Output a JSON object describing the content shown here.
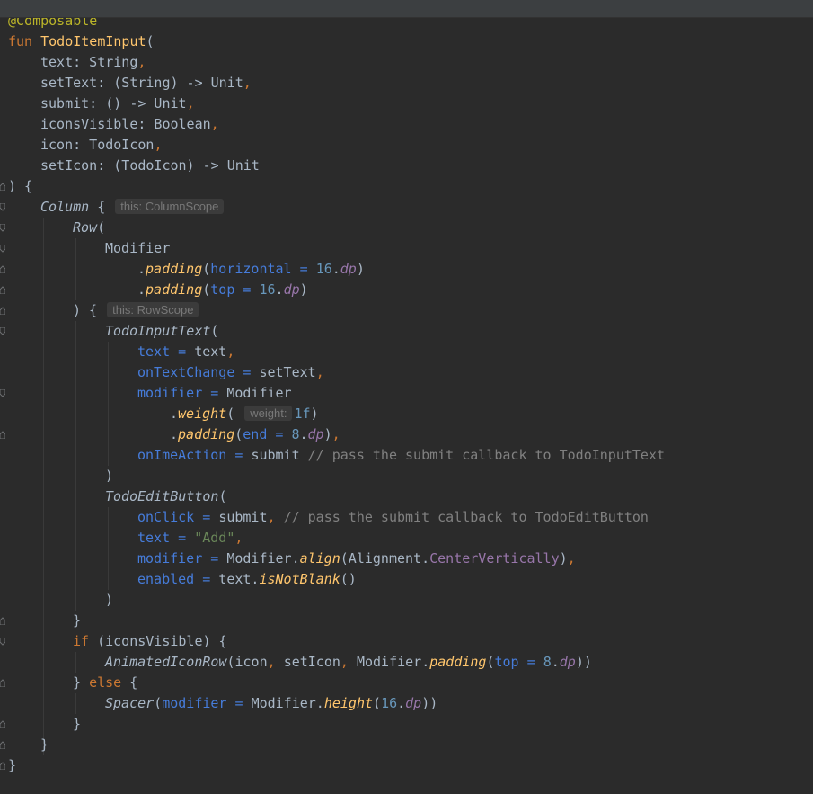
{
  "editor": {
    "language": "Kotlin",
    "lines": [
      {
        "indent": 0,
        "fold": null,
        "tokens": [
          {
            "t": "@Composable",
            "c": "ann"
          }
        ]
      },
      {
        "indent": 0,
        "fold": null,
        "tokens": [
          {
            "t": "fun ",
            "c": "kw"
          },
          {
            "t": "TodoItemInput",
            "c": "fn"
          },
          {
            "t": "(",
            "c": "plain"
          }
        ]
      },
      {
        "indent": 1,
        "fold": null,
        "tokens": [
          {
            "t": "text: String",
            "c": "plain"
          },
          {
            "t": ",",
            "c": "punct-o"
          }
        ]
      },
      {
        "indent": 1,
        "fold": null,
        "tokens": [
          {
            "t": "setText: (String) -> Unit",
            "c": "plain"
          },
          {
            "t": ",",
            "c": "punct-o"
          }
        ]
      },
      {
        "indent": 1,
        "fold": null,
        "tokens": [
          {
            "t": "submit: () -> Unit",
            "c": "plain"
          },
          {
            "t": ",",
            "c": "punct-o"
          }
        ]
      },
      {
        "indent": 1,
        "fold": null,
        "tokens": [
          {
            "t": "iconsVisible: Boolean",
            "c": "plain"
          },
          {
            "t": ",",
            "c": "punct-o"
          }
        ]
      },
      {
        "indent": 1,
        "fold": null,
        "tokens": [
          {
            "t": "icon: TodoIcon",
            "c": "plain"
          },
          {
            "t": ",",
            "c": "punct-o"
          }
        ]
      },
      {
        "indent": 1,
        "fold": null,
        "tokens": [
          {
            "t": "setIcon: (TodoIcon) -> Unit",
            "c": "plain"
          }
        ]
      },
      {
        "indent": 0,
        "fold": "end",
        "tokens": [
          {
            "t": ") {",
            "c": "plain"
          }
        ]
      },
      {
        "indent": 1,
        "fold": "start",
        "tokens": [
          {
            "t": "Column",
            "c": "call"
          },
          {
            "t": " { ",
            "c": "plain"
          },
          {
            "t": "this: ColumnScope",
            "c": "hint"
          }
        ]
      },
      {
        "indent": 2,
        "fold": "start",
        "tokens": [
          {
            "t": "Row",
            "c": "call"
          },
          {
            "t": "(",
            "c": "plain"
          }
        ]
      },
      {
        "indent": 3,
        "fold": "start",
        "tokens": [
          {
            "t": "Modifier",
            "c": "plain"
          }
        ]
      },
      {
        "indent": 4,
        "fold": "end",
        "tokens": [
          {
            "t": ".",
            "c": "plain"
          },
          {
            "t": "padding",
            "c": "ext"
          },
          {
            "t": "(",
            "c": "plain"
          },
          {
            "t": "horizontal = ",
            "c": "named"
          },
          {
            "t": "16",
            "c": "num"
          },
          {
            "t": ".",
            "c": "plain"
          },
          {
            "t": "dp",
            "c": "prop"
          },
          {
            "t": ")",
            "c": "plain"
          }
        ]
      },
      {
        "indent": 4,
        "fold": "end",
        "tokens": [
          {
            "t": ".",
            "c": "plain"
          },
          {
            "t": "padding",
            "c": "ext"
          },
          {
            "t": "(",
            "c": "plain"
          },
          {
            "t": "top = ",
            "c": "named"
          },
          {
            "t": "16",
            "c": "num"
          },
          {
            "t": ".",
            "c": "plain"
          },
          {
            "t": "dp",
            "c": "prop"
          },
          {
            "t": ")",
            "c": "plain"
          }
        ]
      },
      {
        "indent": 2,
        "fold": "end",
        "tokens": [
          {
            "t": ") { ",
            "c": "plain"
          },
          {
            "t": "this: RowScope",
            "c": "hint"
          }
        ]
      },
      {
        "indent": 3,
        "fold": "start",
        "tokens": [
          {
            "t": "TodoInputText",
            "c": "call"
          },
          {
            "t": "(",
            "c": "plain"
          }
        ]
      },
      {
        "indent": 4,
        "fold": null,
        "tokens": [
          {
            "t": "text = ",
            "c": "named"
          },
          {
            "t": "text",
            "c": "plain"
          },
          {
            "t": ",",
            "c": "punct-o"
          }
        ]
      },
      {
        "indent": 4,
        "fold": null,
        "tokens": [
          {
            "t": "onTextChange = ",
            "c": "named"
          },
          {
            "t": "setText",
            "c": "plain"
          },
          {
            "t": ",",
            "c": "punct-o"
          }
        ]
      },
      {
        "indent": 4,
        "fold": "start",
        "tokens": [
          {
            "t": "modifier = ",
            "c": "named"
          },
          {
            "t": "Modifier",
            "c": "plain"
          }
        ]
      },
      {
        "indent": 5,
        "fold": null,
        "tokens": [
          {
            "t": ".",
            "c": "plain"
          },
          {
            "t": "weight",
            "c": "ext"
          },
          {
            "t": "( ",
            "c": "plain"
          },
          {
            "t": "weight:",
            "c": "hint"
          },
          {
            "t": "1f",
            "c": "num"
          },
          {
            "t": ")",
            "c": "plain"
          }
        ]
      },
      {
        "indent": 5,
        "fold": "end",
        "tokens": [
          {
            "t": ".",
            "c": "plain"
          },
          {
            "t": "padding",
            "c": "ext"
          },
          {
            "t": "(",
            "c": "plain"
          },
          {
            "t": "end = ",
            "c": "named"
          },
          {
            "t": "8",
            "c": "num"
          },
          {
            "t": ".",
            "c": "plain"
          },
          {
            "t": "dp",
            "c": "prop"
          },
          {
            "t": ")",
            "c": "plain"
          },
          {
            "t": ",",
            "c": "punct-o"
          }
        ]
      },
      {
        "indent": 4,
        "fold": null,
        "tokens": [
          {
            "t": "onImeAction = ",
            "c": "named"
          },
          {
            "t": "submit ",
            "c": "plain"
          },
          {
            "t": "// pass the submit callback to TodoInputText",
            "c": "comment"
          }
        ]
      },
      {
        "indent": 3,
        "fold": null,
        "tokens": [
          {
            "t": ")",
            "c": "plain"
          }
        ]
      },
      {
        "indent": 3,
        "fold": null,
        "tokens": [
          {
            "t": "TodoEditButton",
            "c": "call"
          },
          {
            "t": "(",
            "c": "plain"
          }
        ]
      },
      {
        "indent": 4,
        "fold": null,
        "tokens": [
          {
            "t": "onClick = ",
            "c": "named"
          },
          {
            "t": "submit",
            "c": "plain"
          },
          {
            "t": ", ",
            "c": "punct-o"
          },
          {
            "t": "// pass the submit callback to TodoEditButton",
            "c": "comment"
          }
        ]
      },
      {
        "indent": 4,
        "fold": null,
        "tokens": [
          {
            "t": "text = ",
            "c": "named"
          },
          {
            "t": "\"Add\"",
            "c": "str"
          },
          {
            "t": ",",
            "c": "punct-o"
          }
        ]
      },
      {
        "indent": 4,
        "fold": null,
        "tokens": [
          {
            "t": "modifier = ",
            "c": "named"
          },
          {
            "t": "Modifier.",
            "c": "plain"
          },
          {
            "t": "align",
            "c": "ext"
          },
          {
            "t": "(Alignment.",
            "c": "plain"
          },
          {
            "t": "CenterVertically",
            "c": "const"
          },
          {
            "t": ")",
            "c": "plain"
          },
          {
            "t": ",",
            "c": "punct-o"
          }
        ]
      },
      {
        "indent": 4,
        "fold": null,
        "tokens": [
          {
            "t": "enabled = ",
            "c": "named"
          },
          {
            "t": "text.",
            "c": "plain"
          },
          {
            "t": "isNotBlank",
            "c": "ext"
          },
          {
            "t": "()",
            "c": "plain"
          }
        ]
      },
      {
        "indent": 3,
        "fold": null,
        "tokens": [
          {
            "t": ")",
            "c": "plain"
          }
        ]
      },
      {
        "indent": 2,
        "fold": "end",
        "tokens": [
          {
            "t": "}",
            "c": "plain"
          }
        ]
      },
      {
        "indent": 2,
        "fold": "start",
        "tokens": [
          {
            "t": "if ",
            "c": "kw"
          },
          {
            "t": "(iconsVisible) {",
            "c": "plain"
          }
        ]
      },
      {
        "indent": 3,
        "fold": null,
        "tokens": [
          {
            "t": "AnimatedIconRow",
            "c": "call"
          },
          {
            "t": "(icon",
            "c": "plain"
          },
          {
            "t": ", ",
            "c": "punct-o"
          },
          {
            "t": "setIcon",
            "c": "plain"
          },
          {
            "t": ", ",
            "c": "punct-o"
          },
          {
            "t": "Modifier.",
            "c": "plain"
          },
          {
            "t": "padding",
            "c": "ext"
          },
          {
            "t": "(",
            "c": "plain"
          },
          {
            "t": "top = ",
            "c": "named"
          },
          {
            "t": "8",
            "c": "num"
          },
          {
            "t": ".",
            "c": "plain"
          },
          {
            "t": "dp",
            "c": "prop"
          },
          {
            "t": "))",
            "c": "plain"
          }
        ]
      },
      {
        "indent": 2,
        "fold": "end",
        "tokens": [
          {
            "t": "} ",
            "c": "plain"
          },
          {
            "t": "else",
            "c": "kw"
          },
          {
            "t": " {",
            "c": "plain"
          }
        ]
      },
      {
        "indent": 3,
        "fold": null,
        "tokens": [
          {
            "t": "Spacer",
            "c": "call"
          },
          {
            "t": "(",
            "c": "plain"
          },
          {
            "t": "modifier = ",
            "c": "named"
          },
          {
            "t": "Modifier.",
            "c": "plain"
          },
          {
            "t": "height",
            "c": "ext"
          },
          {
            "t": "(",
            "c": "plain"
          },
          {
            "t": "16",
            "c": "num"
          },
          {
            "t": ".",
            "c": "plain"
          },
          {
            "t": "dp",
            "c": "prop"
          },
          {
            "t": "))",
            "c": "plain"
          }
        ]
      },
      {
        "indent": 2,
        "fold": "end",
        "tokens": [
          {
            "t": "}",
            "c": "plain"
          }
        ]
      },
      {
        "indent": 1,
        "fold": "end",
        "tokens": [
          {
            "t": "}",
            "c": "plain"
          }
        ]
      },
      {
        "indent": 0,
        "fold": "end",
        "tokens": [
          {
            "t": "}",
            "c": "plain"
          }
        ]
      }
    ]
  },
  "colors": {
    "background": "#2b2b2b",
    "keyword": "#cc7832",
    "function": "#ffc66d",
    "annotation": "#bbb529",
    "named_argument": "#467cda",
    "number": "#6897bb",
    "property": "#9876aa",
    "string": "#6a8759",
    "comment": "#808080",
    "text": "#a9b7c6",
    "inlay_hint_bg": "#3b3b3b",
    "inlay_hint_text": "#787878"
  },
  "icons": {
    "fold_start": "fold-collapse-icon",
    "fold_end": "fold-end-icon"
  }
}
